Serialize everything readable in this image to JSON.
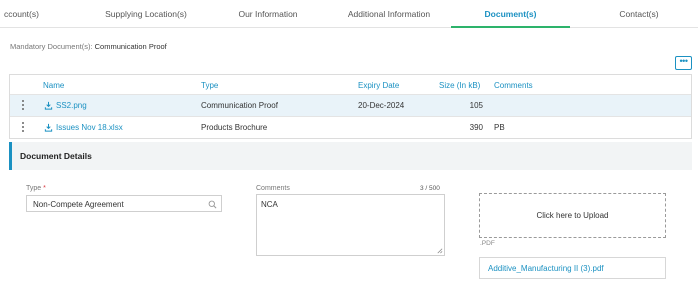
{
  "tabs": [
    {
      "label": "ccount(s)"
    },
    {
      "label": "Supplying Location(s)"
    },
    {
      "label": "Our Information"
    },
    {
      "label": "Additional Information"
    },
    {
      "label": "Document(s)"
    },
    {
      "label": "Contact(s)"
    }
  ],
  "active_tab_index": 4,
  "mandatory": {
    "label": "Mandatory Document(s):",
    "value": "Communication Proof"
  },
  "more_button": {
    "icon": "more-icon",
    "label": "•••"
  },
  "table": {
    "headers": [
      "Name",
      "Type",
      "Expiry Date",
      "Size (In kB)",
      "Comments"
    ],
    "rows": [
      {
        "name": "SS2.png",
        "type": "Communication Proof",
        "expiry": "20-Dec-2024",
        "size": "105",
        "comments": ""
      },
      {
        "name": "Issues Nov 18.xlsx",
        "type": "Products Brochure",
        "expiry": "",
        "size": "390",
        "comments": "PB"
      }
    ]
  },
  "details": {
    "title": "Document Details",
    "type_label": "Type",
    "type_required_mark": "*",
    "type_value": "Non-Compete Agreement",
    "comments_label": "Comments",
    "comments_counter": "3 / 500",
    "comments_value": "NCA",
    "upload_text": "Click here to Upload",
    "upload_ext": ".PDF",
    "uploaded_file": "Additive_Manufacturing II (3).pdf"
  },
  "colors": {
    "accent": "#1b91c2",
    "active_underline": "#2db36b",
    "required": "#d9363e"
  }
}
